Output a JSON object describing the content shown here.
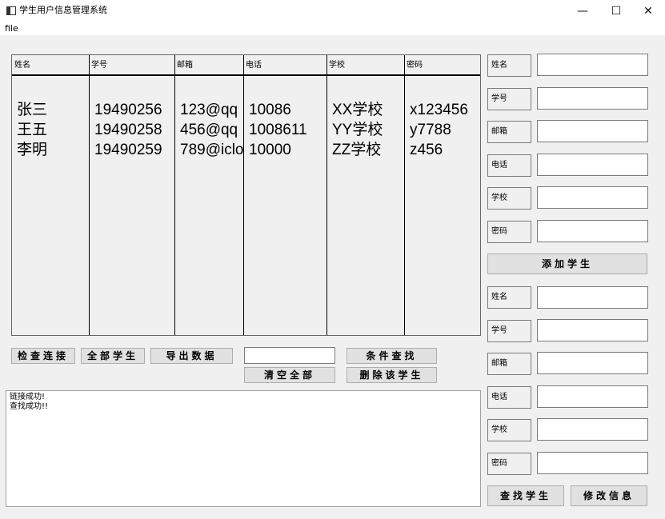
{
  "window": {
    "title": "学生用户信息管理系统",
    "minimize": "—",
    "maximize": "☐",
    "close": "✕",
    "icon": "app-window-icon"
  },
  "menu": {
    "file": "file"
  },
  "table": {
    "headers": [
      "姓名",
      "学号",
      "邮箱",
      "电话",
      "学校",
      "密码"
    ],
    "columns": [
      "张三\n王五\n李明",
      "19490256\n19490258\n19490259",
      "123@qq\n456@qq\n789@iclo",
      "10086\n1008611\n10000",
      "XX学校\nYY学校\nZZ学校",
      "x123456\ny7788\nz456"
    ]
  },
  "buttons": {
    "check_connection": "检查连接",
    "all_students": "全部学生",
    "export_data": "导出数据",
    "clear_all": "清空全部",
    "conditional_search": "条件查找",
    "delete_student": "删除该学生",
    "add_student": "添加学生",
    "find_student": "查找学生",
    "modify_info": "修改信息"
  },
  "search_value": "",
  "add_form": {
    "labels": [
      "姓名",
      "学号",
      "邮箱",
      "电话",
      "学校",
      "密码"
    ]
  },
  "query_form": {
    "labels": [
      "姓名",
      "学号",
      "邮箱",
      "电话",
      "学校",
      "密码"
    ]
  },
  "log": [
    "链接成功!",
    "查找成功!!"
  ]
}
